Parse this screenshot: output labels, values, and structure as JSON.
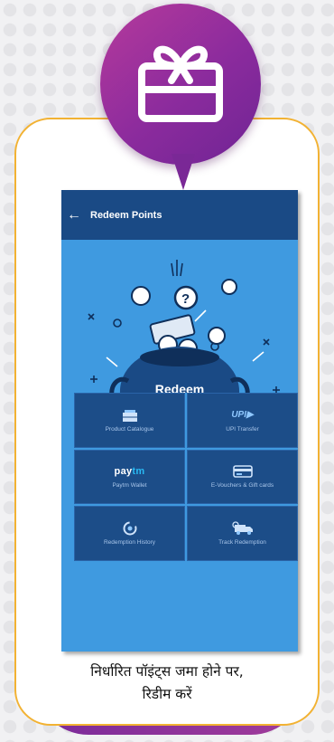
{
  "header": {
    "back_icon": "arrow-left-icon",
    "title": "Redeem Points"
  },
  "hero": {
    "badge_label": "Redeem"
  },
  "tiles": [
    {
      "label": "Product Catalogue",
      "icon": "catalogue-icon"
    },
    {
      "label": "UPI Transfer",
      "icon_text": "UPI▶"
    },
    {
      "label": "Paytm Wallet",
      "brand_left": "pay",
      "brand_right": "tm"
    },
    {
      "label": "E-Vouchers & Gift cards",
      "icon": "card-icon"
    },
    {
      "label": "Redemption History",
      "icon": "history-icon"
    },
    {
      "label": "Track Redemption",
      "icon": "delivery-truck-icon"
    }
  ],
  "caption": {
    "line1": "निर्धारित पॉइंट्स जमा होने पर,",
    "line2": "रिडीम करें"
  },
  "colors": {
    "accent_purple": "#8b2b9d",
    "card_border": "#f2b233",
    "app_bar": "#1a4a85",
    "app_bg": "#3f9ae0"
  }
}
